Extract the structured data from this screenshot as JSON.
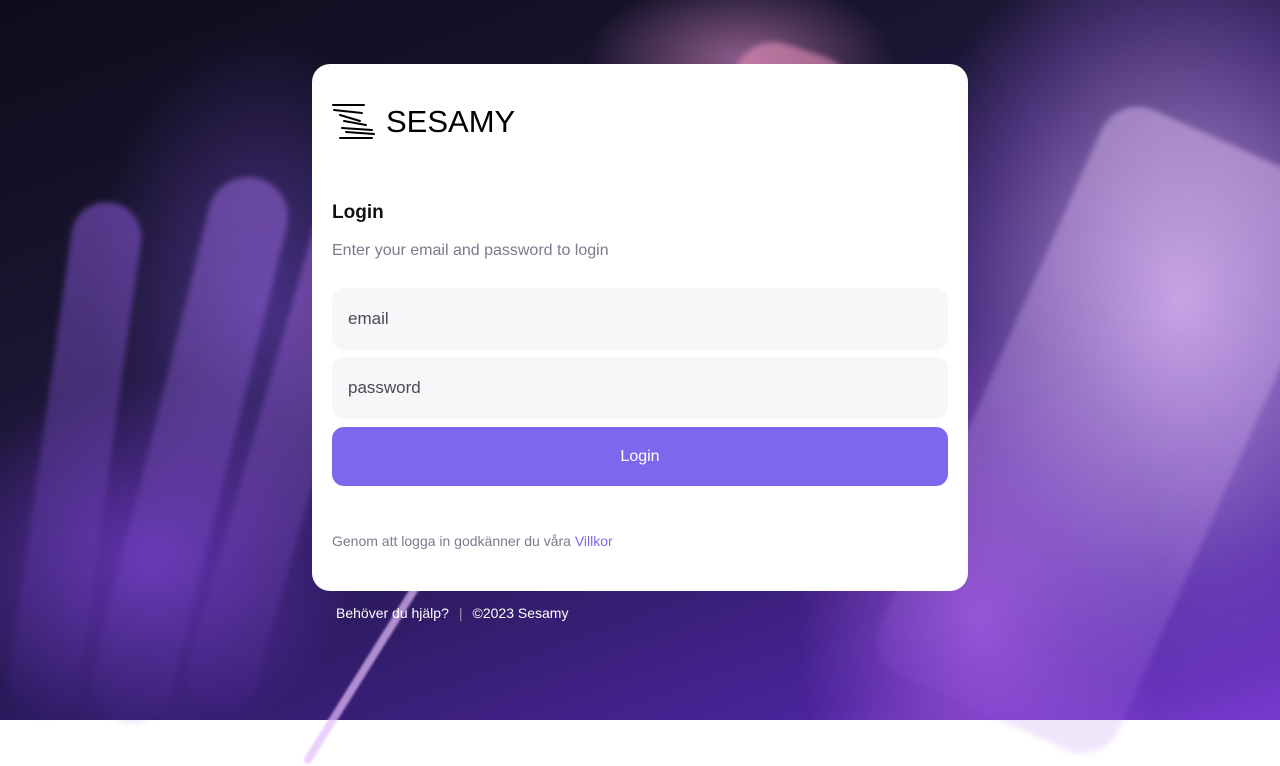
{
  "brand": {
    "name": "SESAMY",
    "logo_icon": "sesamy-stripes-logo",
    "accent_color": "#7b68ee"
  },
  "login": {
    "title": "Login",
    "subtitle": "Enter your email and password to login",
    "email_placeholder": "email",
    "password_placeholder": "password",
    "button_label": "Login",
    "terms_text": "Genom att logga in godkänner du våra ",
    "terms_link": "Villkor"
  },
  "footer": {
    "help_link": "Behöver du hjälp?",
    "separator": "|",
    "copyright": "©2023 Sesamy"
  }
}
